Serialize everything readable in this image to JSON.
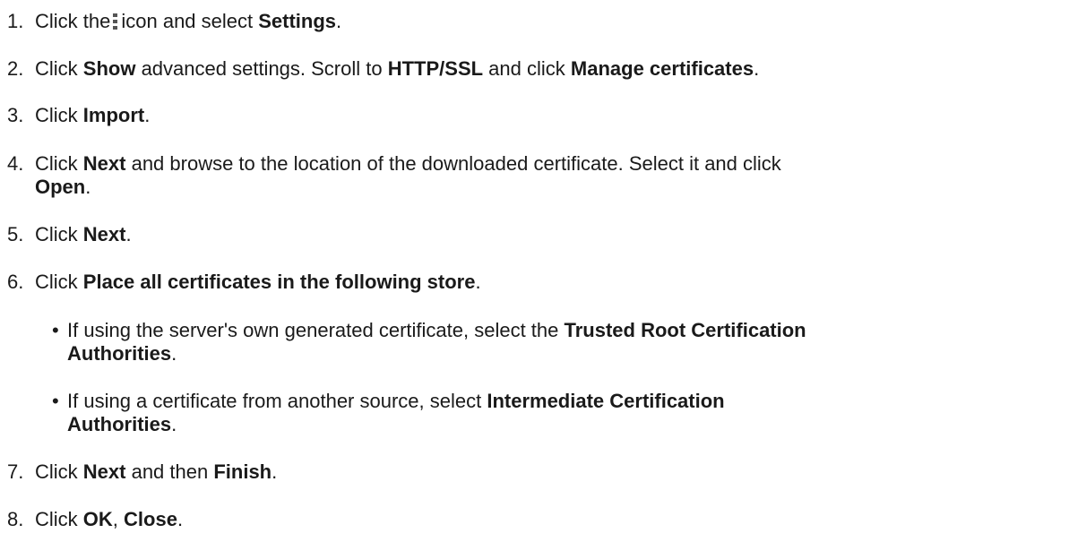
{
  "steps": [
    {
      "num": "1.",
      "t1": "Click the",
      "icon": "kebab-menu-icon",
      "t2": "icon and select ",
      "b1": "Settings",
      "t3": "."
    },
    {
      "num": "2.",
      "t1": "Click ",
      "b1": "Show",
      "t2": " advanced settings. Scroll to ",
      "b2": "HTTP/SSL",
      "t3": " and click ",
      "b3": "Manage certificates",
      "t4": "."
    },
    {
      "num": "3.",
      "t1": "Click ",
      "b1": "Import",
      "t2": "."
    },
    {
      "num": "4.",
      "t1": "Click ",
      "b1": "Next",
      "t2": " and browse to the location of the downloaded certificate. Select it and click",
      "b2": "Open",
      "t3": "."
    },
    {
      "num": "5.",
      "t1": "Click ",
      "b1": "Next",
      "t2": "."
    },
    {
      "num": "6.",
      "t1": "Click ",
      "b1": "Place all certificates in the following store",
      "t2": ".",
      "bullets": [
        {
          "dot": "•",
          "t1": "If using the server's own generated certificate, select the ",
          "b1": "Trusted Root Certification",
          "b2": "Authorities",
          "t2": "."
        },
        {
          "dot": "•",
          "t1": "If using a certificate from another source, select ",
          "b1": "Intermediate Certification",
          "b2": "Authorities",
          "t2": "."
        }
      ]
    },
    {
      "num": "7.",
      "t1": "Click ",
      "b1": "Next",
      "t2": " and then ",
      "b2": "Finish",
      "t3": "."
    },
    {
      "num": "8.",
      "t1": "Click ",
      "b1": "OK",
      "t2": ", ",
      "b2": "Close",
      "t3": "."
    }
  ]
}
